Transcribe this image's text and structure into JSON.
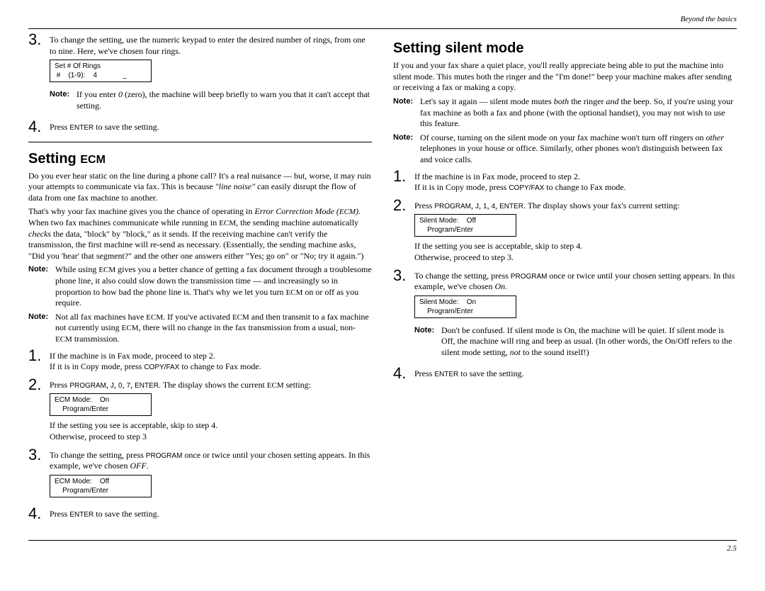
{
  "header": {
    "section": "Beyond the basics"
  },
  "footer": {
    "page": "2.5"
  },
  "left": {
    "step3": {
      "num": "3.",
      "text_a": "To change the setting, use the numeric keypad to enter the desired number of rings, from one to nine. Here, we've chosen four rings.",
      "display_l1": "Set # Of Rings",
      "display_l2": " #    (1-9):    4             _",
      "note_label": "Note:",
      "note_text_a": "If you enter ",
      "note_zero": "0",
      "note_text_b": " (zero), the machine will beep briefly to warn you that it can't accept that setting."
    },
    "step4": {
      "num": "4.",
      "text_a": "Press ",
      "key": "ENTER",
      "text_b": " to save the setting."
    },
    "ecm": {
      "title_a": "Setting ",
      "title_b": "ECM",
      "p1_a": "Do you ever hear static on the line during a phone call? It's a real nuisance — but, worse, it may ruin your attempts to communicate via fax. This is because ",
      "p1_i": "\"line noise\"",
      "p1_b": " can easily disrupt the flow of data from one fax machine to another.",
      "p2_a": "That's why your fax machine gives you the chance of operating in ",
      "p2_i1": "Error Correction Mode (",
      "p2_sc1": "ECM",
      "p2_i1b": ")",
      "p2_b": ". When two fax machines communicate while running in ",
      "p2_sc2": "ECM",
      "p2_c": ", the sending machine automatically ",
      "p2_i2": "checks",
      "p2_d": " the data, \"block\" by \"block,\" as it sends. If the receiving machine can't verify the transmission, the first machine will re-send as necessary. (Essentially, the sending machine asks, \"Did you 'hear' that segment?\" and the other one answers either \"Yes; go on\" or \"No; try it again.\")",
      "note1_label": "Note:",
      "note1_a": "While using ",
      "note1_sc1": "ECM",
      "note1_b": " gives you a better chance of getting a fax document through a troublesome phone line, it also could slow down the transmission time — and increasingly so in proportion to how bad the phone line is. That's why we let you turn ",
      "note1_sc2": "ECM",
      "note1_c": " on or off as you require.",
      "note2_label": "Note:",
      "note2_a": "Not all fax machines have ",
      "note2_sc1": "ECM",
      "note2_b": ". If you've activated ",
      "note2_sc2": "ECM",
      "note2_c": " and then transmit to a fax machine not currently using ",
      "note2_sc3": "ECM",
      "note2_d": ", there will no change in the fax transmission from a usual, non-",
      "note2_sc4": "ECM",
      "note2_e": " transmission.",
      "s1": {
        "num": "1.",
        "a": "If the machine is in Fax mode, proceed to step 2.",
        "b": "If it is in Copy mode, press ",
        "key": "COPY/FAX",
        "c": " to change to Fax mode."
      },
      "s2": {
        "num": "2.",
        "a": "Press ",
        "k1": "PROGRAM",
        "b": ", ",
        "k2": "J",
        "c": ", ",
        "k3": "0",
        "d": ", ",
        "k4": "7",
        "e": ", ",
        "k5": "ENTER",
        "f": ". The display shows the current ",
        "sc": "ECM",
        "g": " setting:",
        "display_l1": "ECM Mode:    On",
        "display_l2": "    Program/Enter",
        "after_a": "If the setting you see is acceptable, skip to step 4.",
        "after_b": "Otherwise, proceed to step 3"
      },
      "s3": {
        "num": "3.",
        "a": "To change the setting, press ",
        "key": "PROGRAM",
        "b": " once or twice until your chosen setting appears. In this example, we've chosen ",
        "i": "OFF",
        "c": ".",
        "display_l1": "ECM Mode:    Off",
        "display_l2": "    Program/Enter"
      },
      "s4": {
        "num": "4.",
        "a": "Press ",
        "key": "ENTER",
        "b": " to save the setting."
      }
    }
  },
  "right": {
    "title": "Setting silent mode",
    "p1": "If you and your fax share a quiet place, you'll really appreciate being able to put the machine into silent mode. This mutes both the ringer and the \"I'm done!\" beep your machine makes after sending or receiving a fax or making a copy.",
    "note1_label": "Note:",
    "note1_a": "Let's say it again — silent mode mutes ",
    "note1_i1": "both",
    "note1_b": " the ringer ",
    "note1_i2": "and",
    "note1_c": " the beep. So, if you're using your fax machine as both a fax and phone (with the optional handset), you may not wish to use this feature.",
    "note2_label": "Note:",
    "note2_a": "Of course, turning on the silent mode on your fax machine won't turn off ringers on ",
    "note2_i": "other",
    "note2_b": " telephones in your house or office. Similarly, other phones won't distinguish between fax and voice calls.",
    "s1": {
      "num": "1.",
      "a": "If the machine is in Fax mode, proceed to step 2.",
      "b": "If it is in Copy mode, press ",
      "key": "COPY/FAX",
      "c": " to change to Fax mode."
    },
    "s2": {
      "num": "2.",
      "a": "Press ",
      "k1": "PROGRAM",
      "b": ", ",
      "k2": "J",
      "c": ", ",
      "k3": "1",
      "d": ", ",
      "k4": "4",
      "e": ", ",
      "k5": "ENTER",
      "f": ". The display shows your fax's current setting:",
      "display_l1": "Silent Mode:    Off",
      "display_l2": "    Program/Enter",
      "after_a": "If the setting you see is acceptable, skip to step 4.",
      "after_b": "Otherwise, proceed to step 3."
    },
    "s3": {
      "num": "3.",
      "a": "To change the setting, press ",
      "key": "PROGRAM",
      "b": " once or twice until your chosen setting appears. In this example, we've chosen ",
      "i": "On",
      "c": ".",
      "display_l1": "Silent Mode:    On",
      "display_l2": "    Program/Enter",
      "note_label": "Note:",
      "note_a": "Don't be confused. If silent mode is On, the machine will be quiet. If silent mode is Off, the machine will ring and beep as usual. (In other words, the On/Off refers to the silent mode setting, ",
      "note_i": "not",
      "note_b": " to the sound itself!)"
    },
    "s4": {
      "num": "4.",
      "a": "Press ",
      "key": "ENTER",
      "b": " to save the setting."
    }
  }
}
